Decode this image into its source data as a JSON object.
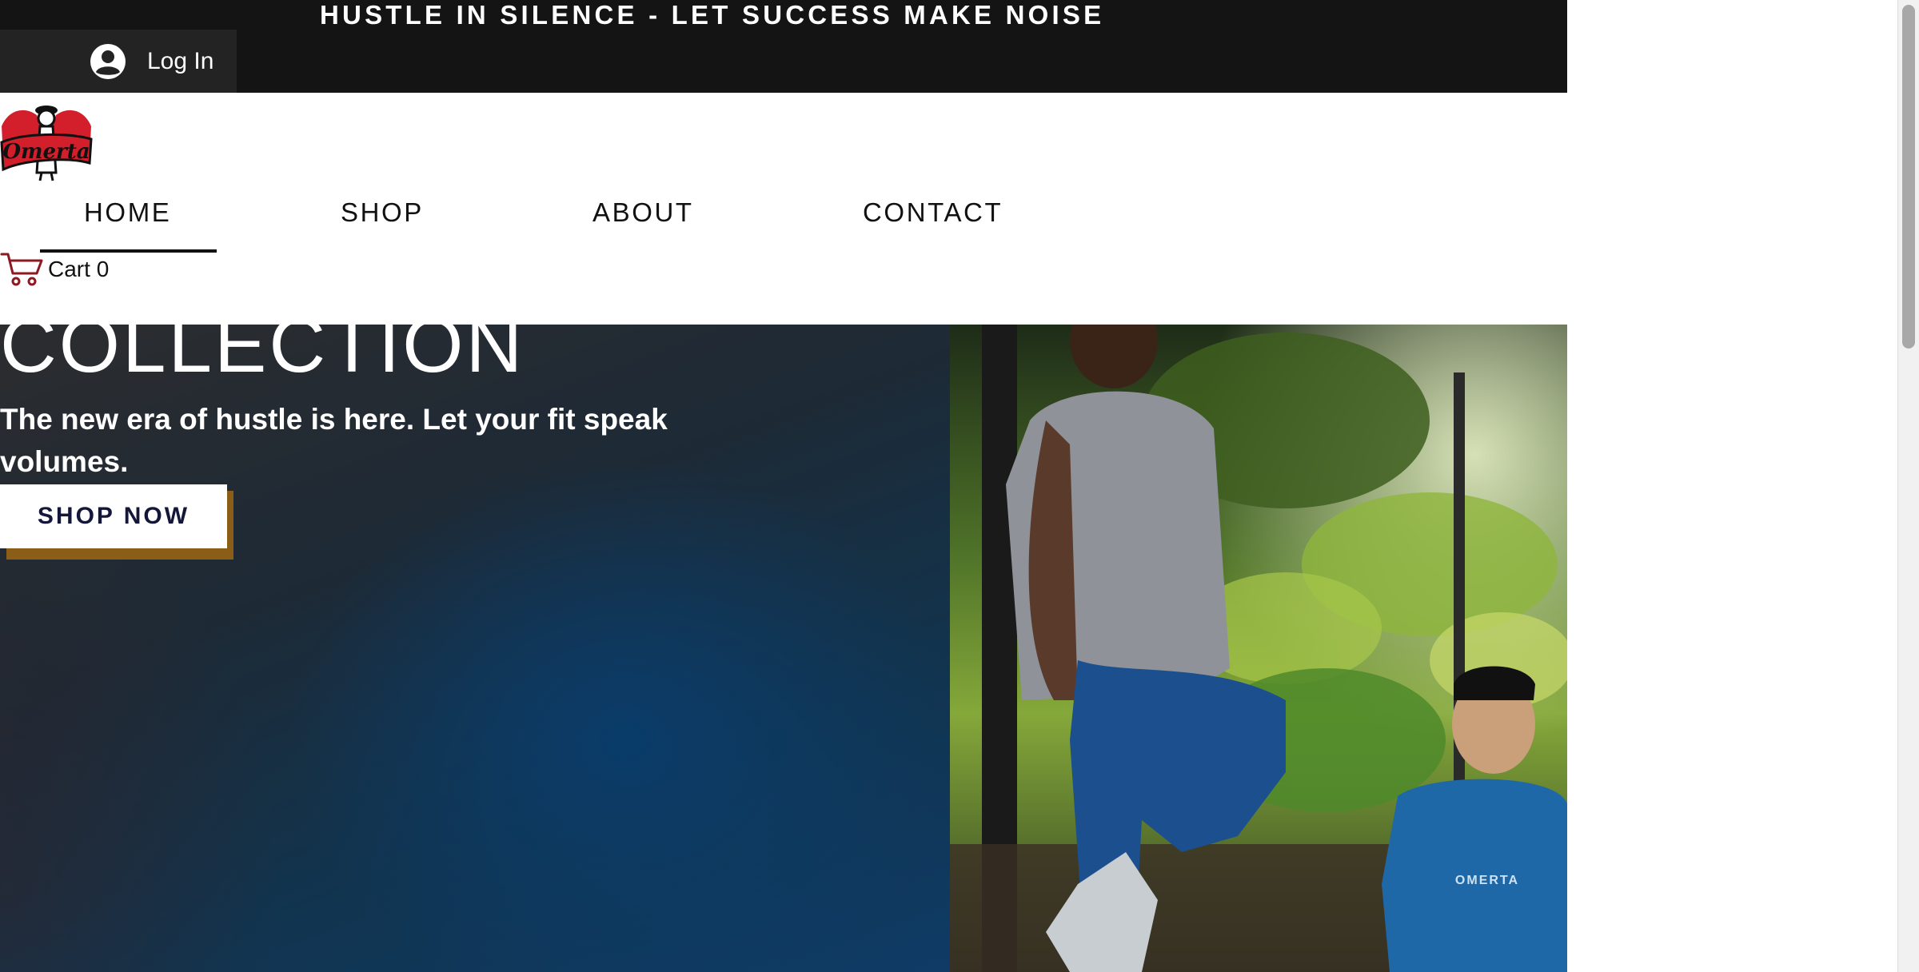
{
  "announcement": {
    "text": "HUSTLE IN SILENCE - LET SUCCESS MAKE NOISE"
  },
  "login": {
    "label": "Log In",
    "icon": "user-avatar-icon"
  },
  "logo": {
    "text": "Omerta",
    "brand_color": "#d21f2b"
  },
  "nav": {
    "items": [
      {
        "label": "HOME",
        "active": true
      },
      {
        "label": "SHOP",
        "active": false
      },
      {
        "label": "ABOUT",
        "active": false
      },
      {
        "label": "CONTACT",
        "active": false
      }
    ]
  },
  "cart": {
    "label": "Cart",
    "count": "0",
    "icon": "shopping-cart-icon",
    "icon_color": "#8b1a22"
  },
  "hero": {
    "title": "COLLECTION",
    "subtitle": "The new era of hustle is here. Let your fit speak volumes.",
    "cta_label": "SHOP NOW",
    "cta_shadow_color": "#8a5e17",
    "shirt_print": "OMERTA"
  },
  "colors": {
    "topbar": "#141414",
    "header": "#ffffff",
    "cta_text": "#15173a"
  }
}
